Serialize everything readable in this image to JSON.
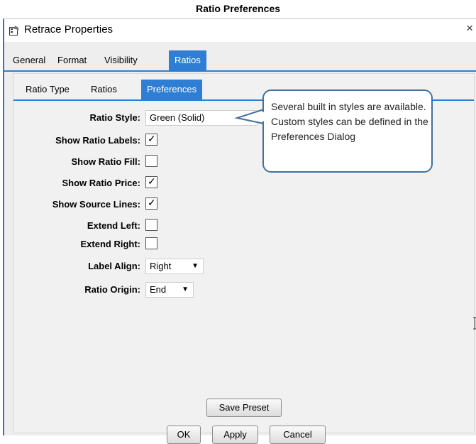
{
  "caption": "Ratio Preferences",
  "window": {
    "title": "Retrace Properties",
    "close": "×"
  },
  "tabs": [
    "General",
    "Format",
    "Visibility",
    "Ratios"
  ],
  "subtabs": [
    "Ratio Type",
    "Ratios",
    "Preferences"
  ],
  "fields": {
    "ratio_style": {
      "label": "Ratio Style:",
      "value": "Green (Solid)"
    },
    "show_ratio_labels": {
      "label": "Show Ratio Labels:",
      "checked": true
    },
    "show_ratio_fill": {
      "label": "Show Ratio Fill:",
      "checked": false
    },
    "show_ratio_price": {
      "label": "Show Ratio Price:",
      "checked": true
    },
    "show_source_lines": {
      "label": "Show Source Lines:",
      "checked": true
    },
    "extend_left": {
      "label": "Extend Left:",
      "checked": false
    },
    "extend_right": {
      "label": "Extend Right:",
      "checked": false
    },
    "label_align": {
      "label": "Label Align:",
      "value": "Right"
    },
    "ratio_origin": {
      "label": "Ratio Origin:",
      "value": "End"
    }
  },
  "check_mark": "✓",
  "dropdown_arrow": "▼",
  "callout": {
    "text": "Several built in styles are available.  Custom styles can be defined in the Preferences Dialog"
  },
  "buttons": {
    "save_preset": "Save Preset",
    "ok": "OK",
    "apply": "Apply",
    "cancel": "Cancel"
  },
  "colors": {
    "accent": "#2e7ed3",
    "callout_border": "#41719c",
    "window_bg": "#eeeeee"
  },
  "icons": {
    "window": "properties-icon",
    "close": "close-icon",
    "cursor": "text-cursor-icon"
  }
}
